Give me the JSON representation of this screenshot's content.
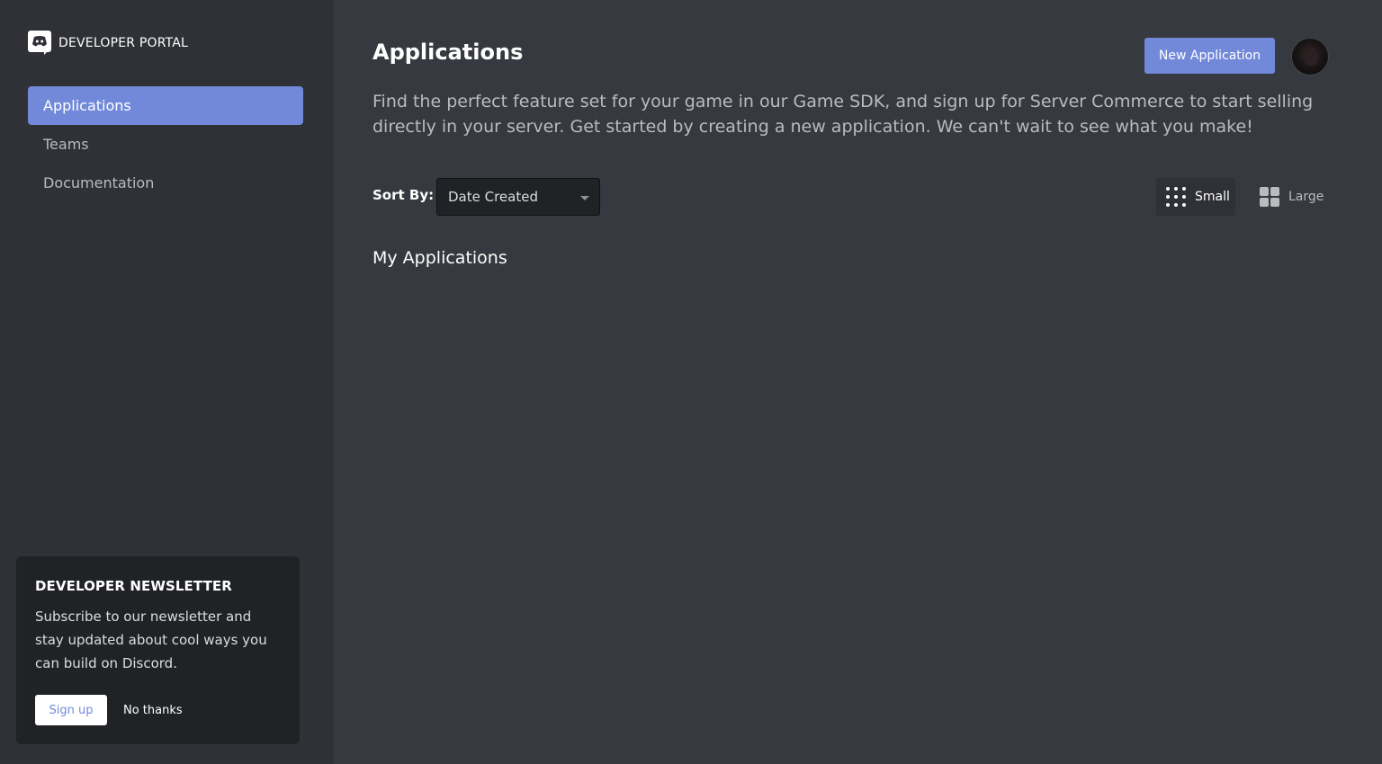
{
  "brand": {
    "name": "DEVELOPER PORTAL",
    "logo_icon": "discord-logo-icon"
  },
  "sidebar": {
    "items": [
      {
        "label": "Applications",
        "active": true
      },
      {
        "label": "Teams",
        "active": false
      },
      {
        "label": "Documentation",
        "active": false
      }
    ]
  },
  "newsletter": {
    "title": "DEVELOPER NEWSLETTER",
    "body": "Subscribe to our newsletter and stay updated about cool ways you can build on Discord.",
    "signup_label": "Sign up",
    "no_thanks_label": "No thanks"
  },
  "header": {
    "title": "Applications",
    "new_app_label": "New Application",
    "description": "Find the perfect feature set for your game in our Game SDK, and sign up for Server Commerce to start selling directly in your server. Get started by creating a new application. We can't wait to see what you make!"
  },
  "sort": {
    "label": "Sort By:",
    "selected": "Date Created"
  },
  "view_toggle": {
    "small_label": "Small",
    "large_label": "Large",
    "selected": "Small"
  },
  "section": {
    "title": "My Applications"
  },
  "colors": {
    "accent": "#7289da",
    "background": "#36393f",
    "sidebar": "#2f3136",
    "panel": "#202225"
  }
}
